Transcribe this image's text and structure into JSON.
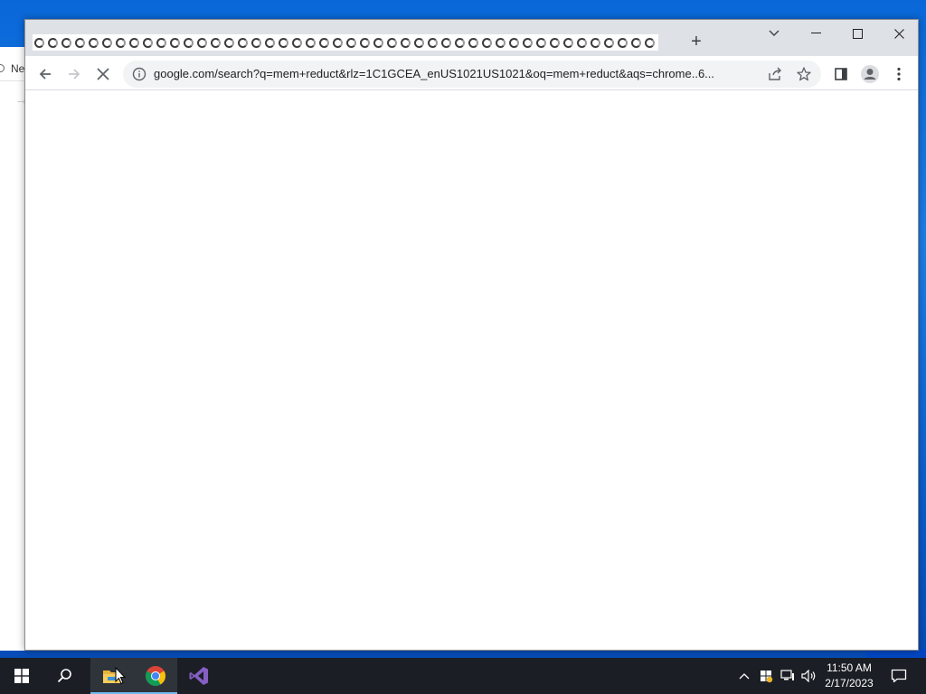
{
  "background_window": {
    "tab_label": "Ne"
  },
  "chrome": {
    "tabs_count": 46,
    "new_tab_label": "+",
    "window_controls": {
      "tab_search": "⌵",
      "minimize": "—",
      "maximize": "☐",
      "close": "✕"
    },
    "toolbar": {
      "url": "google.com/search?q=mem+reduct&rlz=1C1GCEA_enUS1021US1021&oq=mem+reduct&aqs=chrome..6..."
    }
  },
  "taskbar": {
    "clock": {
      "time": "11:50 AM",
      "date": "2/17/2023"
    }
  },
  "colors": {
    "desktop": "#0a67d8",
    "taskbar": "#1b1f25",
    "tabstrip": "#dee1e6",
    "omnibox": "#f1f3f4"
  }
}
